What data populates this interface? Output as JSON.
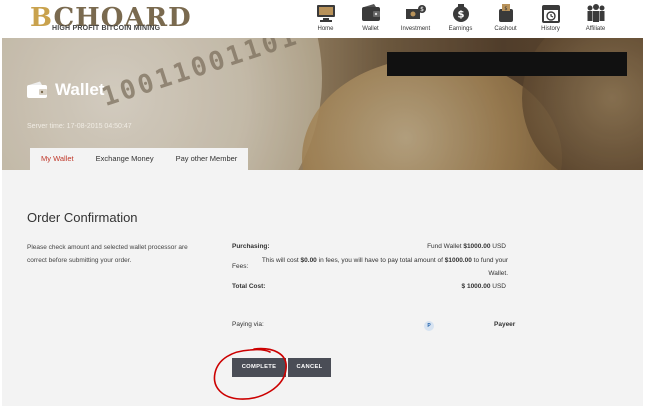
{
  "brand": {
    "logo_main_letter": "B",
    "logo_main_rest": "CHOARD",
    "logo_sub": "HIGH PROFIT BITCOIN MINING"
  },
  "nav": {
    "items": [
      {
        "label": "Home",
        "icon": "home-monitor-icon"
      },
      {
        "label": "Wallet",
        "icon": "wallet-icon"
      },
      {
        "label": "Investment",
        "icon": "investment-icon"
      },
      {
        "label": "Earnings",
        "icon": "earnings-icon"
      },
      {
        "label": "Cashout",
        "icon": "cashout-icon"
      },
      {
        "label": "History",
        "icon": "history-icon"
      },
      {
        "label": "Affiliate",
        "icon": "affiliate-icon"
      }
    ]
  },
  "banner": {
    "coin_digits": "10011001101",
    "title": "Wallet",
    "server_time": "Server time: 17-08-2015 04:50:47"
  },
  "tabs": [
    {
      "label": "My Wallet",
      "active": true
    },
    {
      "label": "Exchange Money",
      "active": false
    },
    {
      "label": "Pay other Member",
      "active": false
    }
  ],
  "order": {
    "title": "Order Confirmation",
    "description": "Please check amount and selected wallet processor are correct before submitting your order.",
    "purchasing_label": "Purchasing:",
    "purchasing_prefix": "Fund Wallet",
    "purchasing_amount": "$1000.00",
    "purchasing_currency": "USD",
    "fees_label": "Fees:",
    "fees_text_1": "This will cost",
    "fees_amount": "$0.00",
    "fees_text_2": "in fees, you will have to pay total amount of",
    "fees_total": "$1000.00",
    "fees_text_3": "to fund your Wallet.",
    "total_label": "Total Cost:",
    "total_amount": "$ 1000.00",
    "total_currency": "USD",
    "paying_label": "Paying via:",
    "payeer_icon_letter": "P",
    "processor": "Payeer"
  },
  "buttons": {
    "complete": "COMPLETE",
    "cancel": "CANCEL"
  },
  "colors": {
    "accent_tab": "#c0392b",
    "button": "#4a4d56",
    "annotation_circle": "#cc0000",
    "content_bg": "#f3f3f3"
  }
}
